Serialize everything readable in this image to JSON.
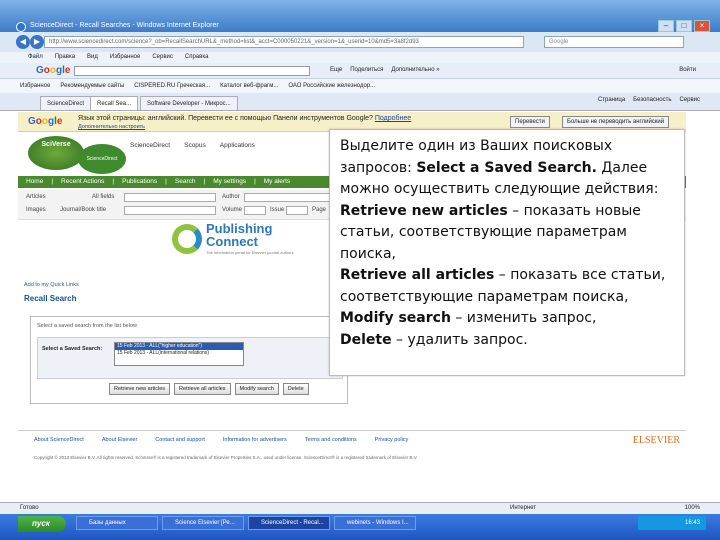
{
  "window": {
    "title": "ScienceDirect - Recall Searches - Windows Internet Explorer",
    "controls": [
      "–",
      "□",
      "×"
    ]
  },
  "address": {
    "url": "http://www.sciencedirect.com/science?_ob=RecallSearchURL&_method=list&_acct=C000050221&_version=1&_userid=10&md5=3a8f2d93",
    "search_placeholder": "Google"
  },
  "menu": [
    "Файл",
    "Правка",
    "Вид",
    "Избранное",
    "Сервис",
    "Справка"
  ],
  "google_toolbar": {
    "items": [
      "Еще",
      "Поделиться",
      "Дополнительно »"
    ],
    "signin": "Войти"
  },
  "favorites": [
    "Избранное",
    "Рекомендуемые сайты",
    "CISPERED.RU Греческая...",
    "Каталог веб-фрагм...",
    "ОАО Российские железнодор..."
  ],
  "tabs": [
    "ScienceDirect",
    "Recall Sea...",
    "Software Developer - Микрос..."
  ],
  "tools": [
    "Страница",
    "Безопасность",
    "Сервис"
  ],
  "translate": {
    "message": "Язык этой страницы: английский. Перевести ее с помощью Панели инструментов Google?",
    "link": "Подробнее",
    "sublink": "Дополнительно настроить",
    "translate_button": "Перевести",
    "never_button": "Больше не переводить английский"
  },
  "page": {
    "sv_logo": "SciVerse",
    "sd_logo": "ScienceDirect",
    "header_links": [
      "ScienceDirect",
      "Scopus",
      "Applications"
    ],
    "nav": [
      "Home",
      "Recent Actions",
      "Publications",
      "Search",
      "My settings",
      "My alerts"
    ],
    "search_labels": [
      "Articles",
      "All fields",
      "Author",
      "Images",
      "Journal/Book title",
      "Volume",
      "Issue",
      "Page"
    ],
    "pc_title_1": "Publishing",
    "pc_title_2": "Connect",
    "pc_sub": "The information portal for Elsevier journal authors",
    "quicklinks": "Add to my Quick Links",
    "recall_title": "Recall Search",
    "recall_hint": "Select a saved search from the list below",
    "saved_label": "Select a Saved Search:",
    "saved_items": [
      "15 Feb 2013 - ALL(\"higher education\")",
      "15 Feb 2013 - ALL(international relations)"
    ],
    "buttons": [
      "Retrieve new articles",
      "Retrieve all articles",
      "Modify search",
      "Delete"
    ],
    "footer_links": [
      "About ScienceDirect",
      "About Elsevier",
      "Contact and support",
      "Information for advertisers",
      "Terms and conditions",
      "Privacy policy"
    ],
    "copyright": "Copyright © 2013 Elsevier B.V. All rights reserved. SciVerse® is a registered trademark of Elsevier Properties S.A., used under license. ScienceDirect® is a registered trademark of Elsevier B.V.",
    "elsevier": "ELSEVIER"
  },
  "callout": {
    "intro": "Выделите один из Ваших поисковых запросов: ",
    "intro_bold": "Select a Saved Search.",
    "line2": " Далее можно осуществить следующие действия:",
    "item1_bold": "Retrieve new articles",
    "item1": " – показать новые статьи, соответствующие параметрам поиска,",
    "item2_bold": "Retrieve all articles",
    "item2": " – показать все статьи, соответствующие параметрам поиска,",
    "item3_bold": "Modify search",
    "item3": " – изменить запрос,",
    "item4_bold": "Delete",
    "item4": " – удалить запрос."
  },
  "status": {
    "left": "Готово",
    "zone": "Интернет",
    "zoom": "100%"
  },
  "taskbar": {
    "start": "пуск",
    "tasks": [
      "Базы данных",
      "Science Elsevier [Ре...",
      "ScienceDirect - Recal...",
      "webinets - Windows I..."
    ],
    "clock": "16:43"
  }
}
